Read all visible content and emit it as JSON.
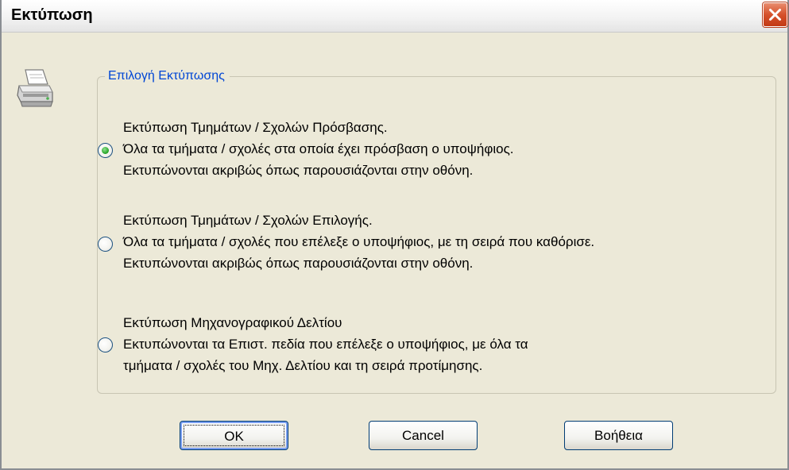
{
  "window": {
    "title": "Εκτύπωση"
  },
  "icons": {
    "close": "close-icon",
    "printer": "printer-icon"
  },
  "group": {
    "legend": "Επιλογή Εκτύπωσης",
    "options": [
      {
        "checked": true,
        "lines": [
          "Εκτύπωση Τμημάτων / Σχολών Πρόσβασης.",
          "Όλα τα τμήματα / σχολές στα οποία έχει πρόσβαση ο υποψήφιος.",
          "Εκτυπώνονται ακριβώς όπως παρουσιάζονται στην οθόνη."
        ]
      },
      {
        "checked": false,
        "lines": [
          "Εκτύπωση Τμημάτων / Σχολών Επιλογής.",
          "Όλα τα τμήματα / σχολές που επέλεξε ο υποψήφιος, με τη σειρά που καθόρισε.",
          "Εκτυπώνονται ακριβώς όπως παρουσιάζονται στην οθόνη."
        ]
      },
      {
        "checked": false,
        "lines": [
          "Εκτύπωση Μηχανογραφικού Δελτίου",
          "Εκτυπώνονται τα Επιστ. πεδία που επέλεξε ο υποψήφιος, με όλα τα",
          "τμήματα / σχολές του Μηχ. Δελτίου και τη σειρά προτίμησης."
        ]
      }
    ]
  },
  "buttons": {
    "ok": "OK",
    "cancel": "Cancel",
    "help": "Βοήθεια"
  },
  "colors": {
    "dialog_bg": "#ece9d8",
    "legend_text": "#0046d5",
    "close_button": "#d6512b",
    "radio_dot": "#21a121"
  }
}
